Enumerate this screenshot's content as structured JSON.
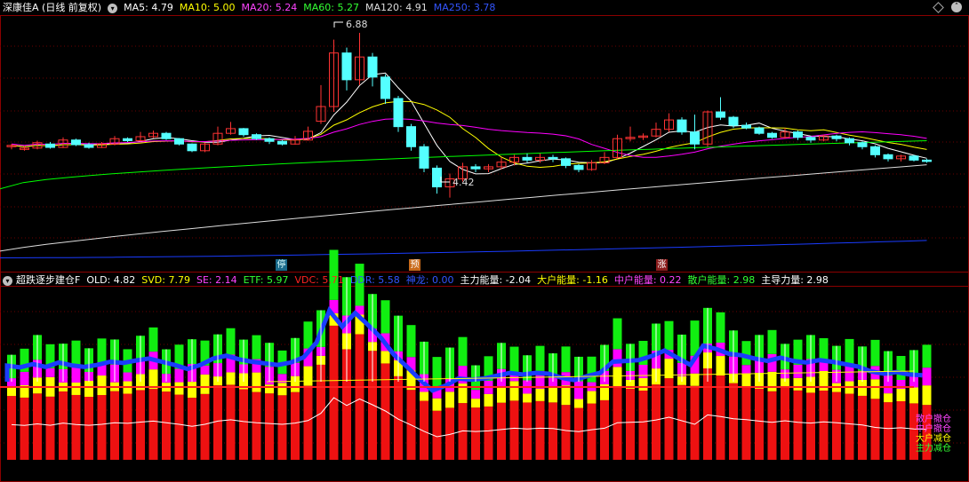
{
  "colors": {
    "bg": "#000000",
    "grid": "#6a0000",
    "border": "#8b0000",
    "up": "#ff3333",
    "down": "#54ffff",
    "ma5": "#ffffff",
    "ma10": "#ffff00",
    "ma20": "#ff00ff",
    "ma60": "#00ff00",
    "ma120": "#dddddd",
    "ma250": "#1a3cff"
  },
  "top_header": {
    "title": "深康佳A (日线 前复权)",
    "chevron_icon": "chevron-down-icon",
    "ma5": "MA5: 4.79",
    "ma10": "MA10: 5.00",
    "ma20": "MA20: 5.24",
    "ma60": "MA60: 5.27",
    "ma120": "MA120: 4.91",
    "ma250": "MA250: 3.78"
  },
  "price_annotations": {
    "high": "6.88",
    "low": "4.42"
  },
  "signal_tags": {
    "ting": "停",
    "yu": "预",
    "zhang": "涨"
  },
  "bottom_header": {
    "indicator": "超跌逐步建仓F",
    "old": "OLD: 4.82",
    "svd": "SVD: 7.79",
    "se": "SE: 2.14",
    "etf": "ETF: 5.97",
    "vdc": "VDC: 5.71",
    "ddr": "DDR: 5.58",
    "shenlong": "神龙: 0.00",
    "zhuli": "主力能量: -2.04",
    "dahu": "大户能量: -1.16",
    "zhonghu": "中户能量: 0.22",
    "sanhu": "散户能量: 2.98",
    "zhudao": "主导力量: 2.98"
  },
  "side_labels": [
    "散户撤仓",
    "中户撤仓",
    "大户减仓",
    "主力减仓"
  ],
  "chart_data": {
    "type": "candlestick",
    "candles": [
      [
        5.18,
        5.2,
        5.22,
        5.14
      ],
      [
        5.14,
        5.16,
        5.19,
        5.12
      ],
      [
        5.16,
        5.24,
        5.27,
        5.14
      ],
      [
        5.22,
        5.17,
        5.25,
        5.15
      ],
      [
        5.17,
        5.28,
        5.32,
        5.16
      ],
      [
        5.28,
        5.21,
        5.3,
        5.19
      ],
      [
        5.21,
        5.17,
        5.24,
        5.15
      ],
      [
        5.17,
        5.22,
        5.25,
        5.16
      ],
      [
        5.22,
        5.3,
        5.34,
        5.2
      ],
      [
        5.3,
        5.27,
        5.32,
        5.25
      ],
      [
        5.27,
        5.33,
        5.4,
        5.26
      ],
      [
        5.33,
        5.38,
        5.42,
        5.31
      ],
      [
        5.38,
        5.3,
        5.4,
        5.28
      ],
      [
        5.3,
        5.22,
        5.31,
        5.2
      ],
      [
        5.22,
        5.12,
        5.23,
        5.1
      ],
      [
        5.12,
        5.22,
        5.24,
        5.1
      ],
      [
        5.22,
        5.38,
        5.48,
        5.2
      ],
      [
        5.38,
        5.45,
        5.55,
        5.36
      ],
      [
        5.45,
        5.36,
        5.46,
        5.33
      ],
      [
        5.36,
        5.3,
        5.38,
        5.28
      ],
      [
        5.3,
        5.26,
        5.32,
        5.22
      ],
      [
        5.26,
        5.22,
        5.28,
        5.2
      ],
      [
        5.22,
        5.28,
        5.34,
        5.21
      ],
      [
        5.28,
        5.41,
        5.48,
        5.27
      ],
      [
        5.56,
        5.78,
        6.1,
        5.52
      ],
      [
        5.78,
        6.58,
        6.78,
        5.7
      ],
      [
        6.58,
        6.18,
        6.66,
        6.02
      ],
      [
        6.18,
        6.52,
        6.88,
        6.1
      ],
      [
        6.52,
        6.22,
        6.58,
        6.08
      ],
      [
        6.22,
        5.9,
        6.26,
        5.82
      ],
      [
        5.9,
        5.48,
        5.94,
        5.4
      ],
      [
        5.48,
        5.18,
        5.52,
        5.12
      ],
      [
        5.18,
        4.86,
        5.22,
        4.8
      ],
      [
        4.86,
        4.58,
        4.9,
        4.48
      ],
      [
        4.58,
        4.7,
        4.78,
        4.42
      ],
      [
        4.7,
        4.88,
        4.94,
        4.66
      ],
      [
        4.88,
        4.85,
        4.92,
        4.8
      ],
      [
        4.85,
        4.88,
        4.92,
        4.8
      ],
      [
        4.88,
        4.95,
        5.02,
        4.84
      ],
      [
        4.95,
        5.02,
        5.06,
        4.9
      ],
      [
        5.02,
        4.98,
        5.08,
        4.94
      ],
      [
        4.98,
        5.02,
        5.08,
        4.94
      ],
      [
        5.02,
        5.0,
        5.06,
        4.95
      ],
      [
        5.0,
        4.9,
        5.02,
        4.86
      ],
      [
        4.9,
        4.84,
        4.92,
        4.8
      ],
      [
        4.84,
        4.94,
        4.98,
        4.82
      ],
      [
        4.94,
        5.02,
        5.1,
        4.92
      ],
      [
        5.02,
        5.3,
        5.36,
        5.0
      ],
      [
        5.3,
        5.32,
        5.48,
        5.26
      ],
      [
        5.32,
        5.34,
        5.38,
        5.28
      ],
      [
        5.34,
        5.44,
        5.54,
        5.32
      ],
      [
        5.44,
        5.58,
        5.68,
        5.4
      ],
      [
        5.58,
        5.4,
        5.62,
        5.36
      ],
      [
        5.4,
        5.22,
        5.66,
        5.14
      ],
      [
        5.22,
        5.7,
        5.72,
        5.18
      ],
      [
        5.7,
        5.62,
        5.92,
        5.58
      ],
      [
        5.62,
        5.5,
        5.64,
        5.46
      ],
      [
        5.5,
        5.46,
        5.54,
        5.44
      ],
      [
        5.46,
        5.38,
        5.48,
        5.36
      ],
      [
        5.38,
        5.32,
        5.4,
        5.3
      ],
      [
        5.32,
        5.4,
        5.46,
        5.3
      ],
      [
        5.4,
        5.32,
        5.42,
        5.28
      ],
      [
        5.32,
        5.28,
        5.34,
        5.24
      ],
      [
        5.28,
        5.34,
        5.36,
        5.26
      ],
      [
        5.34,
        5.3,
        5.36,
        5.26
      ],
      [
        5.3,
        5.24,
        5.32,
        5.2
      ],
      [
        5.24,
        5.18,
        5.26,
        5.14
      ],
      [
        5.18,
        5.06,
        5.2,
        5.02
      ],
      [
        5.06,
        5.0,
        5.08,
        4.96
      ],
      [
        5.0,
        5.04,
        5.06,
        4.96
      ],
      [
        5.04,
        4.98,
        5.06,
        4.96
      ],
      [
        4.98,
        4.96,
        5.0,
        4.94
      ]
    ]
  }
}
